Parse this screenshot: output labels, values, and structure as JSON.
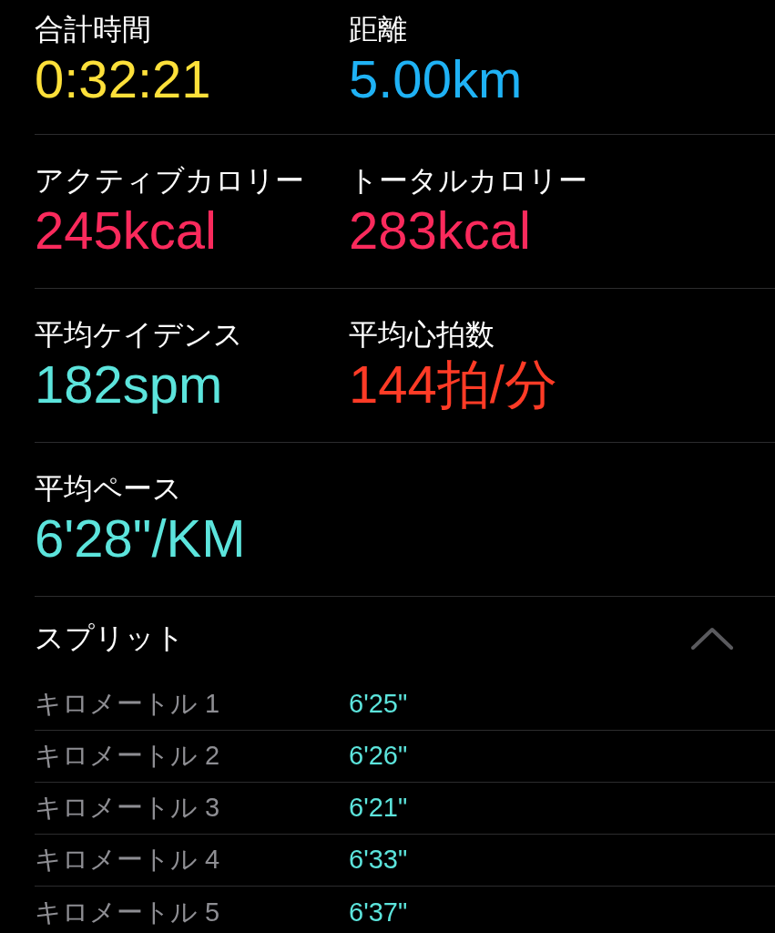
{
  "metrics": [
    {
      "items": [
        {
          "label": "合計時間",
          "value": "0:32:21",
          "color": "#fde03a"
        },
        {
          "label": "距離",
          "value": "5.00km",
          "color": "#1fb2f5"
        }
      ]
    },
    {
      "items": [
        {
          "label": "アクティブカロリー",
          "value": "245kcal",
          "color": "#fa2a5c"
        },
        {
          "label": "トータルカロリー",
          "value": "283kcal",
          "color": "#fa2a5c"
        }
      ]
    },
    {
      "items": [
        {
          "label": "平均ケイデンス",
          "value": "182spm",
          "color": "#5ce4dc"
        },
        {
          "label": "平均心拍数",
          "value": "144拍/分",
          "color": "#ff3b26"
        }
      ]
    },
    {
      "items": [
        {
          "label": "平均ペース",
          "value": "6'28\"/KM",
          "color": "#5ce4dc"
        }
      ]
    }
  ],
  "splits": {
    "title": "スプリット",
    "expanded": true,
    "rows": [
      {
        "label": "キロメートル 1",
        "pace": "6'25\""
      },
      {
        "label": "キロメートル 2",
        "pace": "6'26\""
      },
      {
        "label": "キロメートル 3",
        "pace": "6'21\""
      },
      {
        "label": "キロメートル 4",
        "pace": "6'33\""
      },
      {
        "label": "キロメートル 5",
        "pace": "6'37\""
      }
    ]
  }
}
